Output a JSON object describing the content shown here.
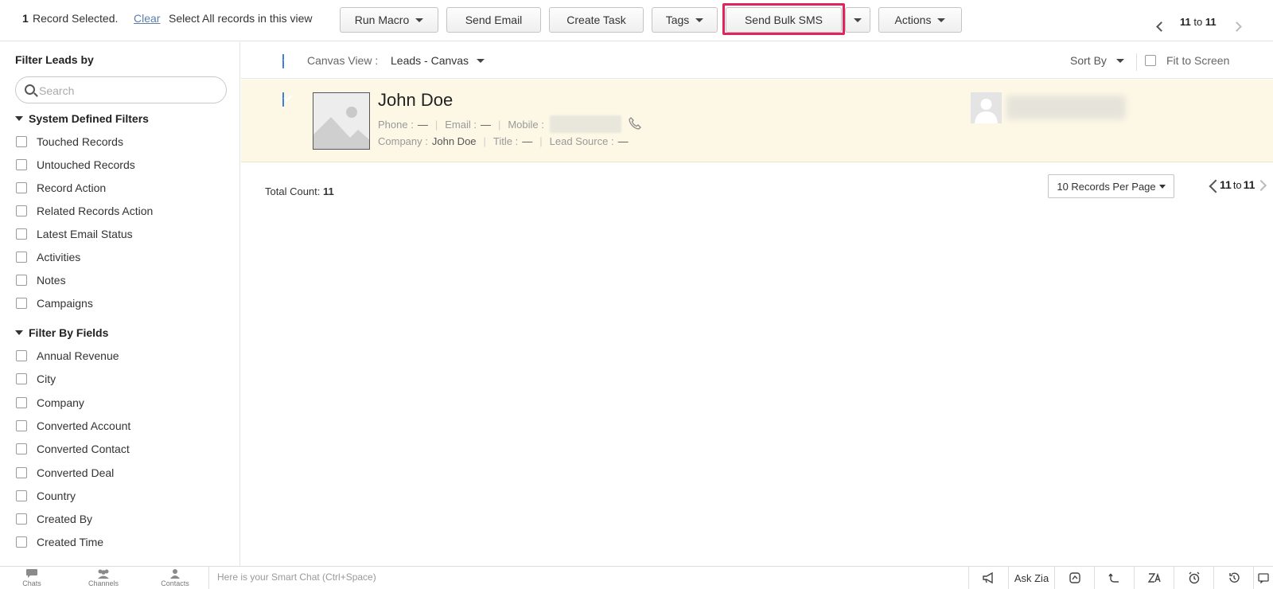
{
  "toolbar": {
    "selected_count": "1",
    "selected_text": "Record Selected.",
    "clear_label": "Clear",
    "select_all_label": "Select All records in this view",
    "run_macro_label": "Run Macro",
    "send_email_label": "Send Email",
    "create_task_label": "Create Task",
    "tags_label": "Tags",
    "send_bulk_sms_label": "Send Bulk SMS",
    "actions_label": "Actions",
    "highlight_color": "#e0245e",
    "pager": {
      "from": "11",
      "sep": "to",
      "to": "11"
    }
  },
  "sidebar": {
    "title": "Filter Leads by",
    "search_placeholder": "Search",
    "system_section": "System Defined Filters",
    "system_filters": [
      "Touched Records",
      "Untouched Records",
      "Record Action",
      "Related Records Action",
      "Latest Email Status",
      "Activities",
      "Notes",
      "Campaigns"
    ],
    "fields_section": "Filter By Fields",
    "field_filters": [
      "Annual Revenue",
      "City",
      "Company",
      "Converted Account",
      "Converted Contact",
      "Converted Deal",
      "Country",
      "Created By",
      "Created Time"
    ]
  },
  "viewbar": {
    "label": "Canvas View :",
    "view_name": "Leads - Canvas",
    "sort_by": "Sort By",
    "fit_to_screen": "Fit to Screen"
  },
  "record": {
    "name": "John Doe",
    "phone_label": "Phone :",
    "phone_value": "—",
    "email_label": "Email :",
    "email_value": "—",
    "mobile_label": "Mobile :",
    "company_label": "Company :",
    "company_value": "John Doe",
    "title_label": "Title :",
    "title_value": "—",
    "lead_source_label": "Lead Source :",
    "lead_source_value": "—",
    "row_color": "#fdf8e6"
  },
  "footer": {
    "total_label": "Total Count:",
    "total_value": "11",
    "per_page": "10 Records Per Page",
    "pager": {
      "from": "11",
      "sep": "to",
      "to": "11"
    }
  },
  "bottombar": {
    "nav": [
      "Chats",
      "Channels",
      "Contacts"
    ],
    "chat_placeholder": "Here is your Smart Chat (Ctrl+Space)",
    "ask_zia": "Ask Zia"
  }
}
